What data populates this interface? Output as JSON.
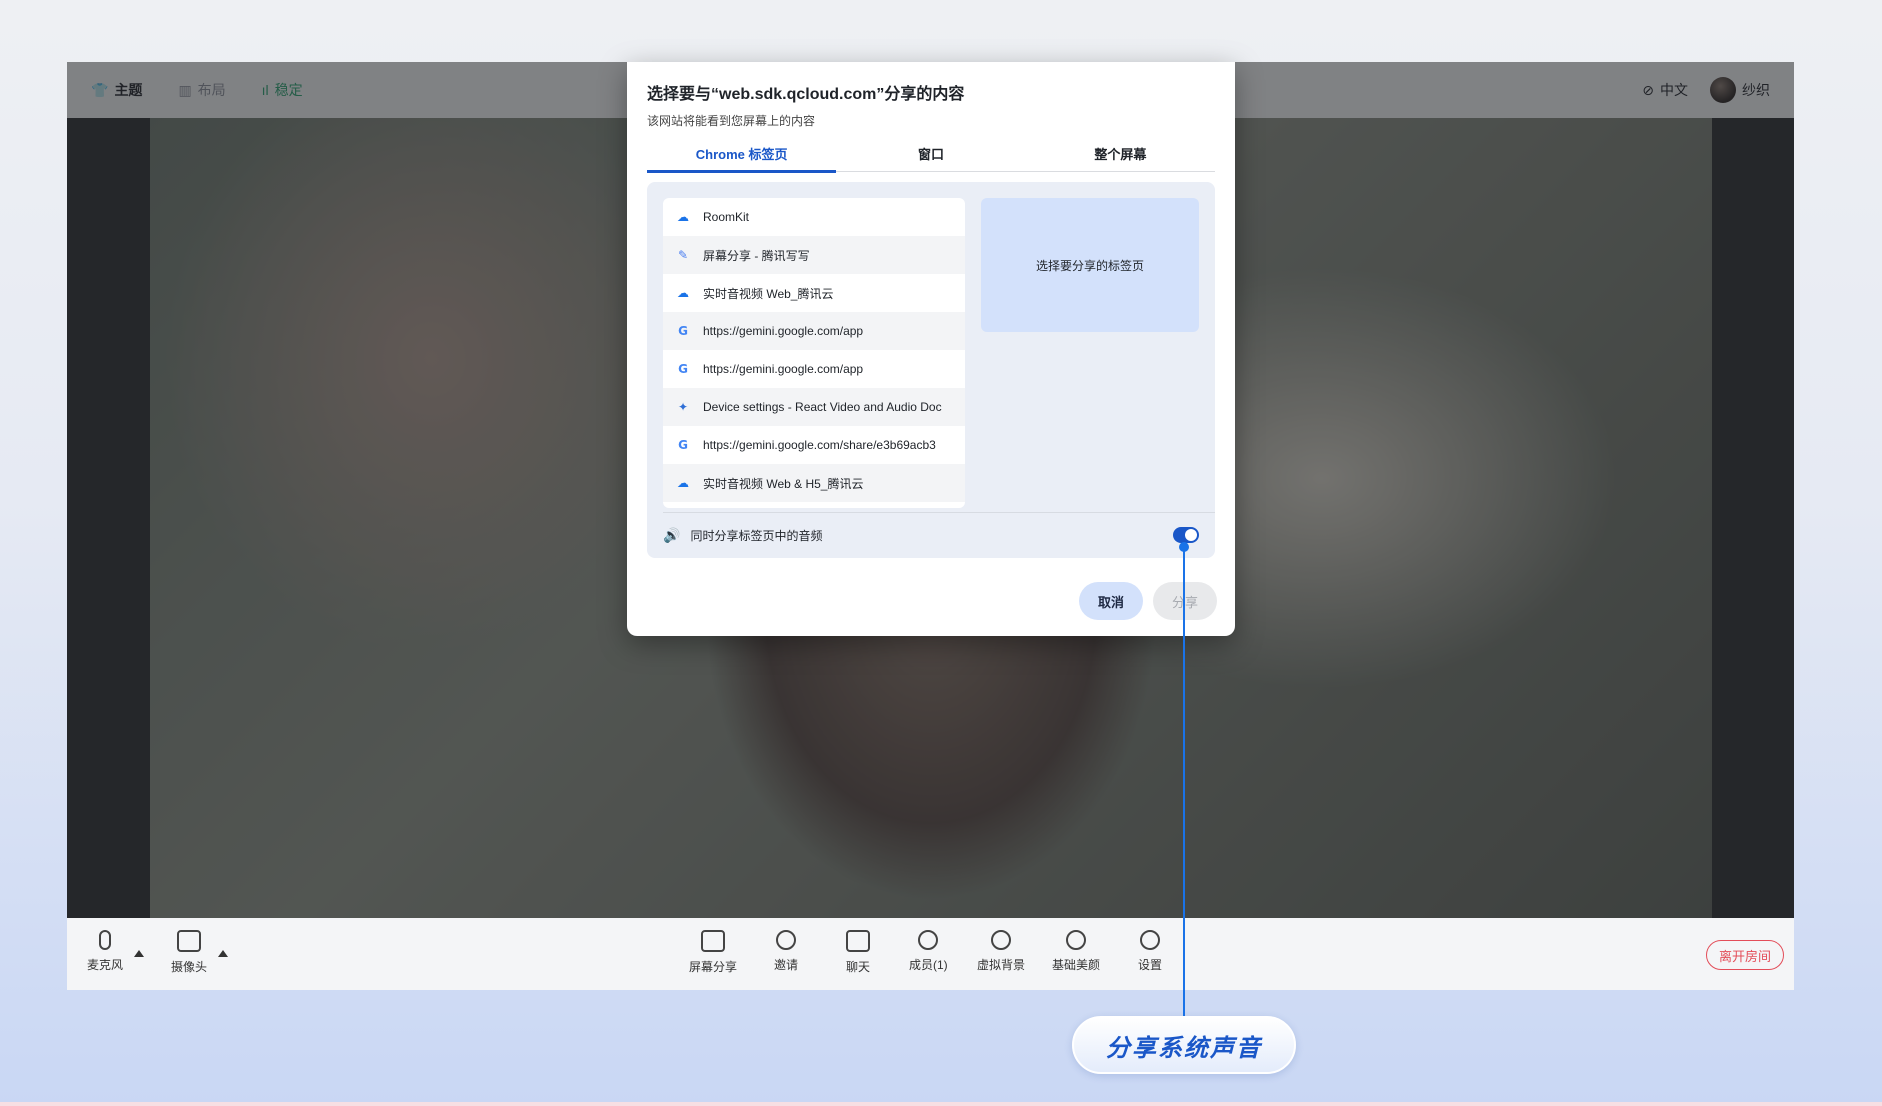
{
  "topbar": {
    "theme": "主题",
    "layout": "布局",
    "status": "稳定",
    "language": "中文",
    "username": "纱织"
  },
  "toolbar": {
    "mic": "麦克风",
    "camera": "摄像头",
    "screen_share": "屏幕分享",
    "invite": "邀请",
    "chat": "聊天",
    "members": "成员(1)",
    "virtual_bg": "虚拟背景",
    "beauty": "基础美颜",
    "settings": "设置",
    "leave": "离开房间"
  },
  "dialog": {
    "title": "选择要与“web.sdk.qcloud.com”分享的内容",
    "subtitle": "该网站将能看到您屏幕上的内容",
    "tabs": [
      "Chrome 标签页",
      "窗口",
      "整个屏幕"
    ],
    "tab_items": [
      {
        "icon": "cloud",
        "label": "RoomKit"
      },
      {
        "icon": "pen",
        "label": "屏幕分享 - 腾讯写写"
      },
      {
        "icon": "cloud",
        "label": "实时音视频 Web_腾讯云"
      },
      {
        "icon": "google",
        "label": "https://gemini.google.com/app"
      },
      {
        "icon": "google",
        "label": "https://gemini.google.com/app"
      },
      {
        "icon": "bird",
        "label": "Device settings - React Video and Audio Doc"
      },
      {
        "icon": "google",
        "label": "https://gemini.google.com/share/e3b69acb3"
      },
      {
        "icon": "cloud",
        "label": "实时音视频 Web & H5_腾讯云"
      }
    ],
    "preview_placeholder": "选择要分享的标签页",
    "audio_label": "同时分享标签页中的音频",
    "audio_enabled": true,
    "cancel": "取消",
    "share": "分享"
  },
  "annotation": {
    "label": "分享系统声音"
  }
}
